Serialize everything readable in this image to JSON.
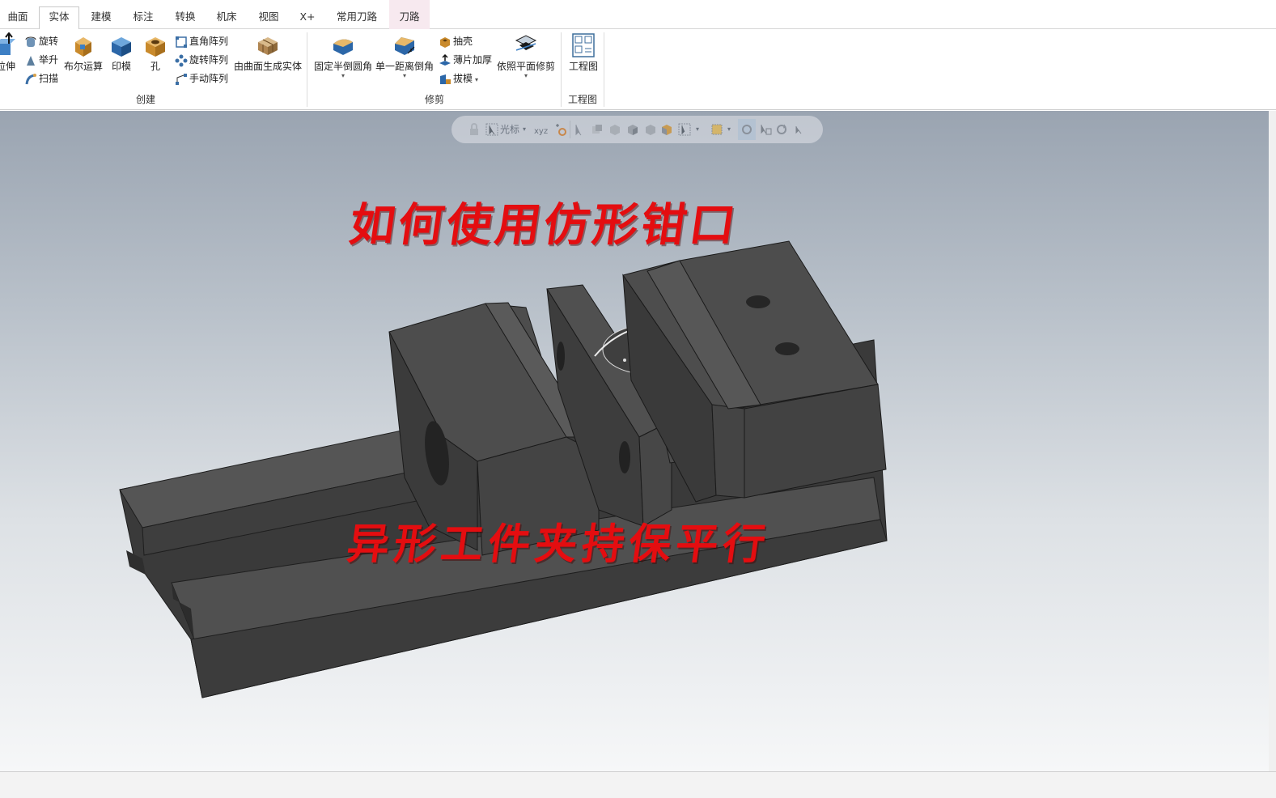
{
  "tabs": [
    {
      "label": "曲面"
    },
    {
      "label": "实体"
    },
    {
      "label": "建模"
    },
    {
      "label": "标注"
    },
    {
      "label": "转换"
    },
    {
      "label": "机床"
    },
    {
      "label": "视图"
    },
    {
      "label": "X+"
    },
    {
      "label": "常用刀路"
    },
    {
      "label": "刀路"
    }
  ],
  "active_tab": "实体",
  "ribbon": {
    "create": {
      "group_label": "创建",
      "extrude": "拉伸",
      "revolve": "旋转",
      "loft": "举升",
      "sweep": "扫描",
      "boolean": "布尔运算",
      "impression": "印模",
      "hole": "孔",
      "rect_pattern": "直角阵列",
      "rot_pattern": "旋转阵列",
      "manual_pattern": "手动阵列",
      "solid_from_surface": "由曲面生成实体"
    },
    "modify": {
      "group_label": "修剪",
      "const_fillet": "固定半倒圆角",
      "dist_chamfer": "单一距离倒角",
      "shell": "抽壳",
      "thicken": "薄片加厚",
      "draft": "拔模",
      "trim_to_plane": "依照平面修剪"
    },
    "drawing": {
      "group_label": "工程图",
      "layout": "工程图"
    }
  },
  "floating_toolbar": {
    "cursor_label": "光标",
    "xyz_label": "xyz"
  },
  "overlay": {
    "title": "如何使用仿形钳口",
    "subtitle": "异形工件夹持保平行"
  },
  "colors": {
    "overlay_text": "#e40d10",
    "model_face": "#4a4a4a",
    "viewport_top": "#9aa4b1",
    "viewport_bottom": "#f6f7f8"
  }
}
